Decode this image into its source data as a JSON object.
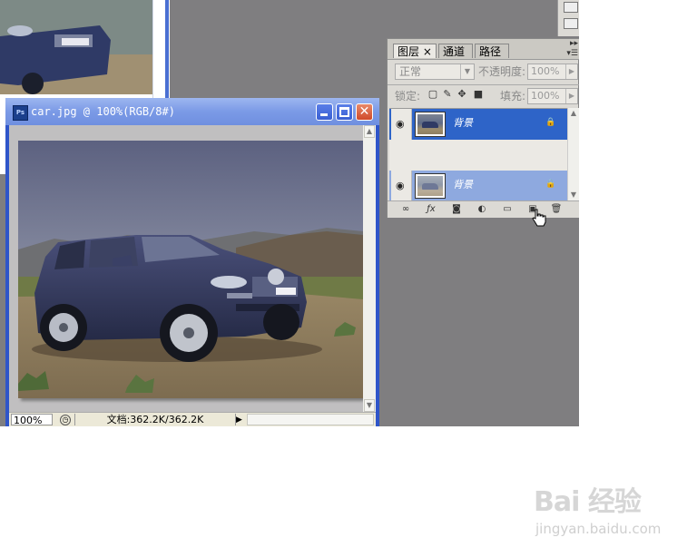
{
  "document": {
    "title": "car.jpg @ 100%(RGB/8#)",
    "icon_text": "Ps",
    "zoom": "100%",
    "doc_info": "文档:362.2K/362.2K"
  },
  "layers_panel": {
    "tabs": [
      {
        "label": "图层",
        "close": "×",
        "active": true
      },
      {
        "label": "通道",
        "active": false
      },
      {
        "label": "路径",
        "active": false
      }
    ],
    "blend_mode": "正常",
    "opacity_label": "不透明度:",
    "opacity_value": "100%",
    "lock_label": "锁定:",
    "fill_label": "填充:",
    "fill_value": "100%",
    "layers": [
      {
        "name": "背景",
        "selected": true
      },
      {
        "name": "背景",
        "selected": false
      }
    ],
    "bottom_icons": [
      "link-icon",
      "fx-icon",
      "mask-icon",
      "adjustment-icon",
      "folder-icon",
      "new-layer-icon",
      "trash-icon"
    ]
  },
  "watermark": {
    "text": "Bai 经验",
    "url": "jingyan.baidu.com"
  },
  "colors": {
    "workspace": "#7f7e80",
    "title_bar": "#7b9ae6",
    "selected_layer": "#2e64c8",
    "highlight_layer": "#8ea9df"
  }
}
